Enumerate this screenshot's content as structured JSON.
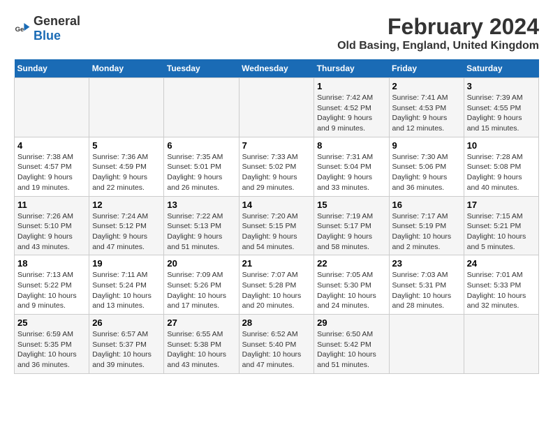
{
  "logo": {
    "general": "General",
    "blue": "Blue"
  },
  "title": "February 2024",
  "subtitle": "Old Basing, England, United Kingdom",
  "days_of_week": [
    "Sunday",
    "Monday",
    "Tuesday",
    "Wednesday",
    "Thursday",
    "Friday",
    "Saturday"
  ],
  "weeks": [
    [
      {
        "day": "",
        "info": ""
      },
      {
        "day": "",
        "info": ""
      },
      {
        "day": "",
        "info": ""
      },
      {
        "day": "",
        "info": ""
      },
      {
        "day": "1",
        "info": "Sunrise: 7:42 AM\nSunset: 4:52 PM\nDaylight: 9 hours and 9 minutes."
      },
      {
        "day": "2",
        "info": "Sunrise: 7:41 AM\nSunset: 4:53 PM\nDaylight: 9 hours and 12 minutes."
      },
      {
        "day": "3",
        "info": "Sunrise: 7:39 AM\nSunset: 4:55 PM\nDaylight: 9 hours and 15 minutes."
      }
    ],
    [
      {
        "day": "4",
        "info": "Sunrise: 7:38 AM\nSunset: 4:57 PM\nDaylight: 9 hours and 19 minutes."
      },
      {
        "day": "5",
        "info": "Sunrise: 7:36 AM\nSunset: 4:59 PM\nDaylight: 9 hours and 22 minutes."
      },
      {
        "day": "6",
        "info": "Sunrise: 7:35 AM\nSunset: 5:01 PM\nDaylight: 9 hours and 26 minutes."
      },
      {
        "day": "7",
        "info": "Sunrise: 7:33 AM\nSunset: 5:02 PM\nDaylight: 9 hours and 29 minutes."
      },
      {
        "day": "8",
        "info": "Sunrise: 7:31 AM\nSunset: 5:04 PM\nDaylight: 9 hours and 33 minutes."
      },
      {
        "day": "9",
        "info": "Sunrise: 7:30 AM\nSunset: 5:06 PM\nDaylight: 9 hours and 36 minutes."
      },
      {
        "day": "10",
        "info": "Sunrise: 7:28 AM\nSunset: 5:08 PM\nDaylight: 9 hours and 40 minutes."
      }
    ],
    [
      {
        "day": "11",
        "info": "Sunrise: 7:26 AM\nSunset: 5:10 PM\nDaylight: 9 hours and 43 minutes."
      },
      {
        "day": "12",
        "info": "Sunrise: 7:24 AM\nSunset: 5:12 PM\nDaylight: 9 hours and 47 minutes."
      },
      {
        "day": "13",
        "info": "Sunrise: 7:22 AM\nSunset: 5:13 PM\nDaylight: 9 hours and 51 minutes."
      },
      {
        "day": "14",
        "info": "Sunrise: 7:20 AM\nSunset: 5:15 PM\nDaylight: 9 hours and 54 minutes."
      },
      {
        "day": "15",
        "info": "Sunrise: 7:19 AM\nSunset: 5:17 PM\nDaylight: 9 hours and 58 minutes."
      },
      {
        "day": "16",
        "info": "Sunrise: 7:17 AM\nSunset: 5:19 PM\nDaylight: 10 hours and 2 minutes."
      },
      {
        "day": "17",
        "info": "Sunrise: 7:15 AM\nSunset: 5:21 PM\nDaylight: 10 hours and 5 minutes."
      }
    ],
    [
      {
        "day": "18",
        "info": "Sunrise: 7:13 AM\nSunset: 5:22 PM\nDaylight: 10 hours and 9 minutes."
      },
      {
        "day": "19",
        "info": "Sunrise: 7:11 AM\nSunset: 5:24 PM\nDaylight: 10 hours and 13 minutes."
      },
      {
        "day": "20",
        "info": "Sunrise: 7:09 AM\nSunset: 5:26 PM\nDaylight: 10 hours and 17 minutes."
      },
      {
        "day": "21",
        "info": "Sunrise: 7:07 AM\nSunset: 5:28 PM\nDaylight: 10 hours and 20 minutes."
      },
      {
        "day": "22",
        "info": "Sunrise: 7:05 AM\nSunset: 5:30 PM\nDaylight: 10 hours and 24 minutes."
      },
      {
        "day": "23",
        "info": "Sunrise: 7:03 AM\nSunset: 5:31 PM\nDaylight: 10 hours and 28 minutes."
      },
      {
        "day": "24",
        "info": "Sunrise: 7:01 AM\nSunset: 5:33 PM\nDaylight: 10 hours and 32 minutes."
      }
    ],
    [
      {
        "day": "25",
        "info": "Sunrise: 6:59 AM\nSunset: 5:35 PM\nDaylight: 10 hours and 36 minutes."
      },
      {
        "day": "26",
        "info": "Sunrise: 6:57 AM\nSunset: 5:37 PM\nDaylight: 10 hours and 39 minutes."
      },
      {
        "day": "27",
        "info": "Sunrise: 6:55 AM\nSunset: 5:38 PM\nDaylight: 10 hours and 43 minutes."
      },
      {
        "day": "28",
        "info": "Sunrise: 6:52 AM\nSunset: 5:40 PM\nDaylight: 10 hours and 47 minutes."
      },
      {
        "day": "29",
        "info": "Sunrise: 6:50 AM\nSunset: 5:42 PM\nDaylight: 10 hours and 51 minutes."
      },
      {
        "day": "",
        "info": ""
      },
      {
        "day": "",
        "info": ""
      }
    ]
  ]
}
